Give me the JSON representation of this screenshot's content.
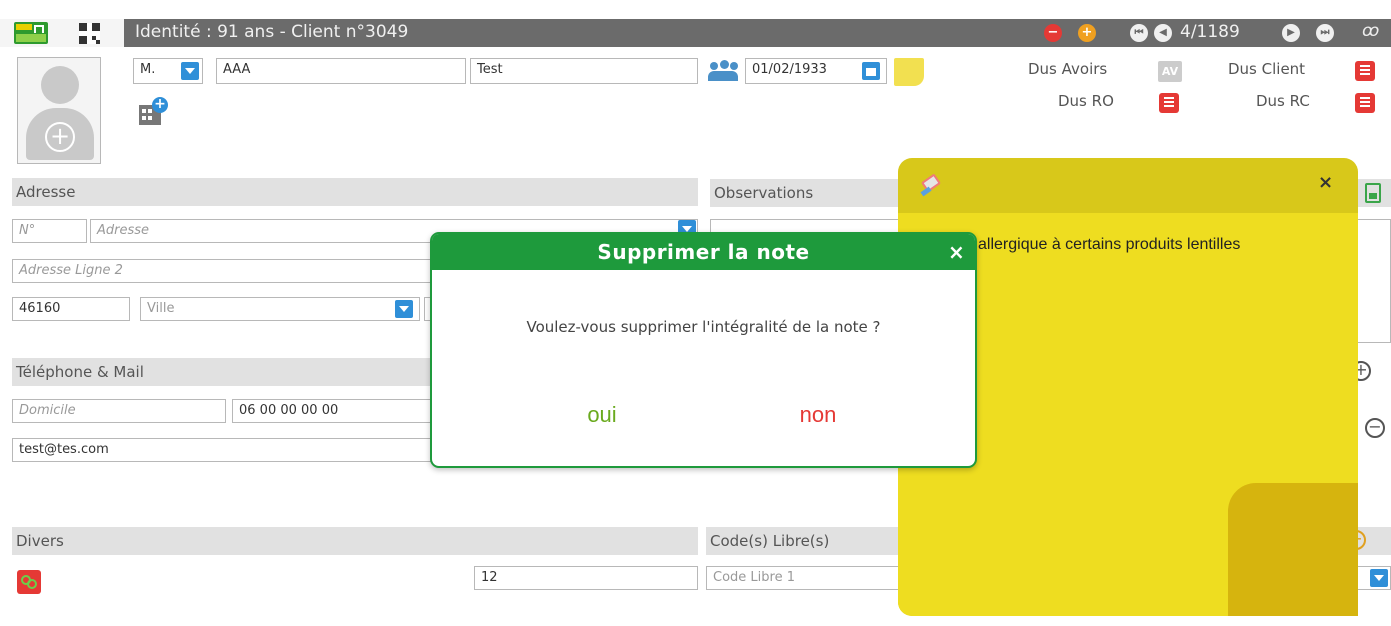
{
  "header": {
    "title": "Identité : 91 ans - Client n°3049",
    "pager": "4/1189",
    "vitale_text": "Vitale"
  },
  "identity": {
    "civility": "M.",
    "last_name": "AAA",
    "first_name": "Test",
    "birth_date": "01/02/1933"
  },
  "dues": {
    "avoirs_label": "Dus Avoirs",
    "av_badge": "AV",
    "client_label": "Dus Client",
    "ro_label": "Dus RO",
    "rc_label": "Dus RC"
  },
  "address": {
    "section_title": "Adresse",
    "number_placeholder": "N°",
    "street_placeholder": "Adresse",
    "line2_placeholder": "Adresse Ligne 2",
    "postal_code": "46160",
    "city_placeholder": "Ville"
  },
  "observations": {
    "section_title": "Observations"
  },
  "contact": {
    "section_title": "Téléphone & Mail",
    "phone_type_placeholder": "Domicile",
    "phone_number": "06 00 00 00 00",
    "email": "test@tes.com"
  },
  "misc": {
    "section_title": "Divers",
    "misc_value": "12"
  },
  "free_codes": {
    "section_title": "Code(s) Libre(s)",
    "code1_placeholder": "Code Libre 1"
  },
  "sticky_note": {
    "text": "allergique à certains produits lentilles",
    "close_label": "×"
  },
  "dialog": {
    "title": "Supprimer la note",
    "close_label": "×",
    "message": "Voulez-vous supprimer l'intégralité de la note ?",
    "yes_label": "oui",
    "no_label": "non"
  },
  "colors": {
    "header_bg": "#6b6b6b",
    "dialog_green": "#1e9a3c",
    "note_yellow": "#d8c81a",
    "no_red": "#e53935",
    "yes_green": "#6aaa1e"
  }
}
